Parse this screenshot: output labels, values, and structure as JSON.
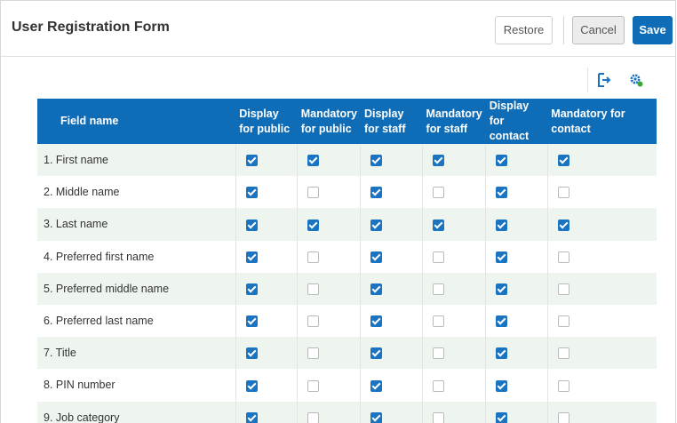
{
  "header": {
    "title": "User Registration Form",
    "restore_label": "Restore",
    "cancel_label": "Cancel",
    "save_label": "Save"
  },
  "toolbar": {
    "icons": [
      "export-icon",
      "gear-icon"
    ]
  },
  "colors": {
    "accent": "#0f6db8",
    "row_alt": "#eef5ee",
    "gear_dot": "#3aa63a"
  },
  "table": {
    "columns": [
      {
        "label": "Field name"
      },
      {
        "label": "Display for public"
      },
      {
        "label": "Mandatory for public"
      },
      {
        "label": "Display for staff"
      },
      {
        "label": "Mandatory for staff"
      },
      {
        "label": "Display for contact"
      },
      {
        "label": "Mandatory for contact"
      }
    ],
    "rows": [
      {
        "name": "1. First name",
        "checks": [
          true,
          true,
          true,
          true,
          true,
          true
        ]
      },
      {
        "name": "2. Middle name",
        "checks": [
          true,
          false,
          true,
          false,
          true,
          false
        ]
      },
      {
        "name": "3. Last name",
        "checks": [
          true,
          true,
          true,
          true,
          true,
          true
        ]
      },
      {
        "name": "4. Preferred first name",
        "checks": [
          true,
          false,
          true,
          false,
          true,
          false
        ]
      },
      {
        "name": "5. Preferred middle name",
        "checks": [
          true,
          false,
          true,
          false,
          true,
          false
        ]
      },
      {
        "name": "6. Preferred last name",
        "checks": [
          true,
          false,
          true,
          false,
          true,
          false
        ]
      },
      {
        "name": "7. Title",
        "checks": [
          true,
          false,
          true,
          false,
          true,
          false
        ]
      },
      {
        "name": "8. PIN number",
        "checks": [
          true,
          false,
          true,
          false,
          true,
          false
        ]
      },
      {
        "name": "9. Job category",
        "checks": [
          true,
          false,
          true,
          false,
          true,
          false
        ]
      }
    ]
  }
}
